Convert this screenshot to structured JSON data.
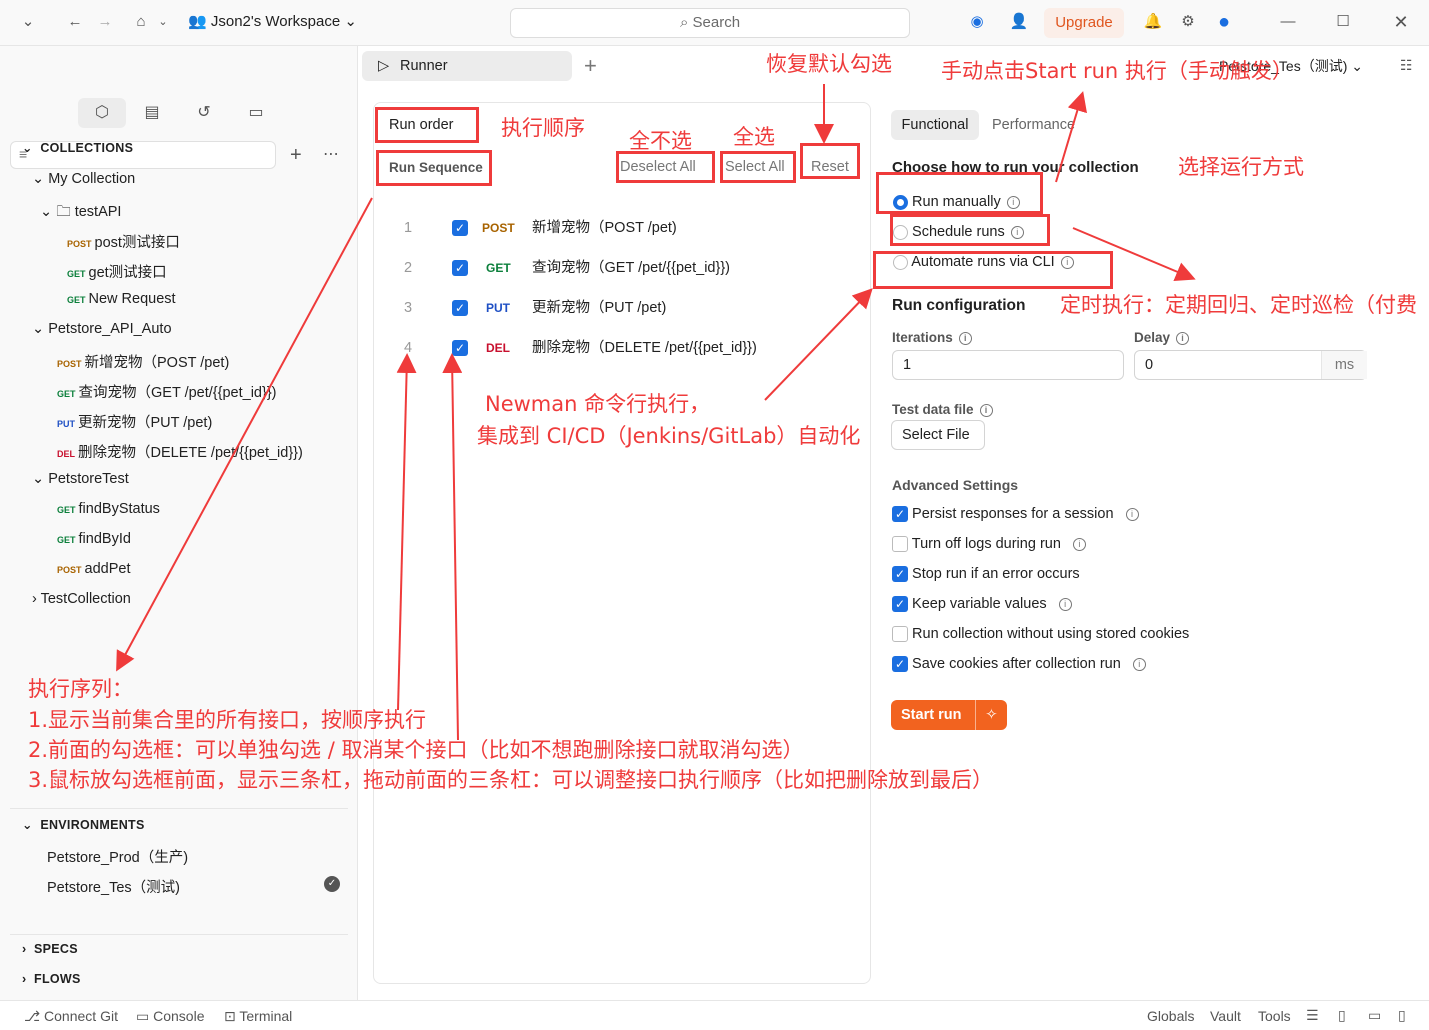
{
  "titlebar": {
    "workspace": "Json2's Workspace",
    "search": "Search",
    "upgrade": "Upgrade"
  },
  "sidebar": {
    "collections_header": "COLLECTIONS",
    "tree": [
      {
        "label": "My Collection"
      },
      {
        "label": "testAPI"
      },
      {
        "method": "POST",
        "label": "post测试接口"
      },
      {
        "method": "GET",
        "label": "get测试接口"
      },
      {
        "method": "GET",
        "label": "New Request"
      },
      {
        "label": "Petstore_API_Auto"
      },
      {
        "method": "POST",
        "label": "新增宠物（POST /pet)"
      },
      {
        "method": "GET",
        "label": "查询宠物（GET /pet/{{pet_id}})"
      },
      {
        "method": "PUT",
        "label": "更新宠物（PUT /pet)"
      },
      {
        "method": "DEL",
        "label": "删除宠物（DELETE /pet/{{pet_id}})"
      },
      {
        "label": "PetstoreTest"
      },
      {
        "method": "GET",
        "label": "findByStatus"
      },
      {
        "method": "GET",
        "label": "findById"
      },
      {
        "method": "POST",
        "label": "addPet"
      },
      {
        "label": "TestCollection"
      }
    ],
    "environments_header": "ENVIRONMENTS",
    "environments": [
      "Petstore_Prod（生产)",
      "Petstore_Tes（测试)"
    ],
    "specs_header": "SPECS",
    "flows_header": "FLOWS"
  },
  "runner": {
    "tab_label": "Runner",
    "env_select": "Petstore_Tes（测试)",
    "run_order": "Run order",
    "run_sequence": "Run Sequence",
    "deselect_all": "Deselect All",
    "select_all": "Select All",
    "reset": "Reset",
    "requests": [
      {
        "n": "1",
        "method": "POST",
        "label": "新增宠物（POST /pet)"
      },
      {
        "n": "2",
        "method": "GET",
        "label": "查询宠物（GET /pet/{{pet_id}})"
      },
      {
        "n": "3",
        "method": "PUT",
        "label": "更新宠物（PUT /pet)"
      },
      {
        "n": "4",
        "method": "DEL",
        "label": "删除宠物（DELETE /pet/{{pet_id}})"
      }
    ]
  },
  "config": {
    "tab_functional": "Functional",
    "tab_performance": "Performance",
    "choose_title": "Choose how to run your collection",
    "run_manually": "Run manually",
    "schedule_runs": "Schedule runs",
    "automate_cli": "Automate runs via CLI",
    "run_configuration": "Run configuration",
    "iterations_label": "Iterations",
    "iterations_value": "1",
    "delay_label": "Delay",
    "delay_value": "0",
    "delay_unit": "ms",
    "test_data_label": "Test data file",
    "select_file": "Select File",
    "advanced": "Advanced Settings",
    "options": [
      {
        "label": "Persist responses for a session",
        "checked": true
      },
      {
        "label": "Turn off logs during run",
        "checked": false
      },
      {
        "label": "Stop run if an error occurs",
        "checked": true
      },
      {
        "label": "Keep variable values",
        "checked": true
      },
      {
        "label": "Run collection without using stored cookies",
        "checked": false
      },
      {
        "label": "Save cookies after collection run",
        "checked": true
      }
    ],
    "start_run": "Start run"
  },
  "statusbar": {
    "connect_git": "Connect Git",
    "console": "Console",
    "terminal": "Terminal",
    "globals": "Globals",
    "vault": "Vault",
    "tools": "Tools"
  },
  "annotations": {
    "restore_default": "恢复默认勾选",
    "manual_start": "手动点击Start run 执行（手动触发）",
    "exec_order": "执行顺序",
    "deselect_none": "全不选",
    "select_all": "全选",
    "choose_mode": "选择运行方式",
    "scheduled": "定时执行：定期回归、定时巡检（付费",
    "newman1": "Newman 命令行执行，",
    "newman2": "集成到 CI/CD（Jenkins/GitLab）自动化",
    "seq_title": "执行序列：",
    "seq1": "1.显示当前集合里的所有接口，按顺序执行",
    "seq2": "2.前面的勾选框：可以单独勾选 / 取消某个接口（比如不想跑删除接口就取消勾选）",
    "seq3": "3.鼠标放勾选框前面，显示三条杠，拖动前面的三条杠：可以调整接口执行顺序（比如把删除放到最后）"
  },
  "colors": {
    "accent": "#f2631f",
    "checkbox": "#1a6ee0",
    "annotation": "#ef3b3b"
  }
}
